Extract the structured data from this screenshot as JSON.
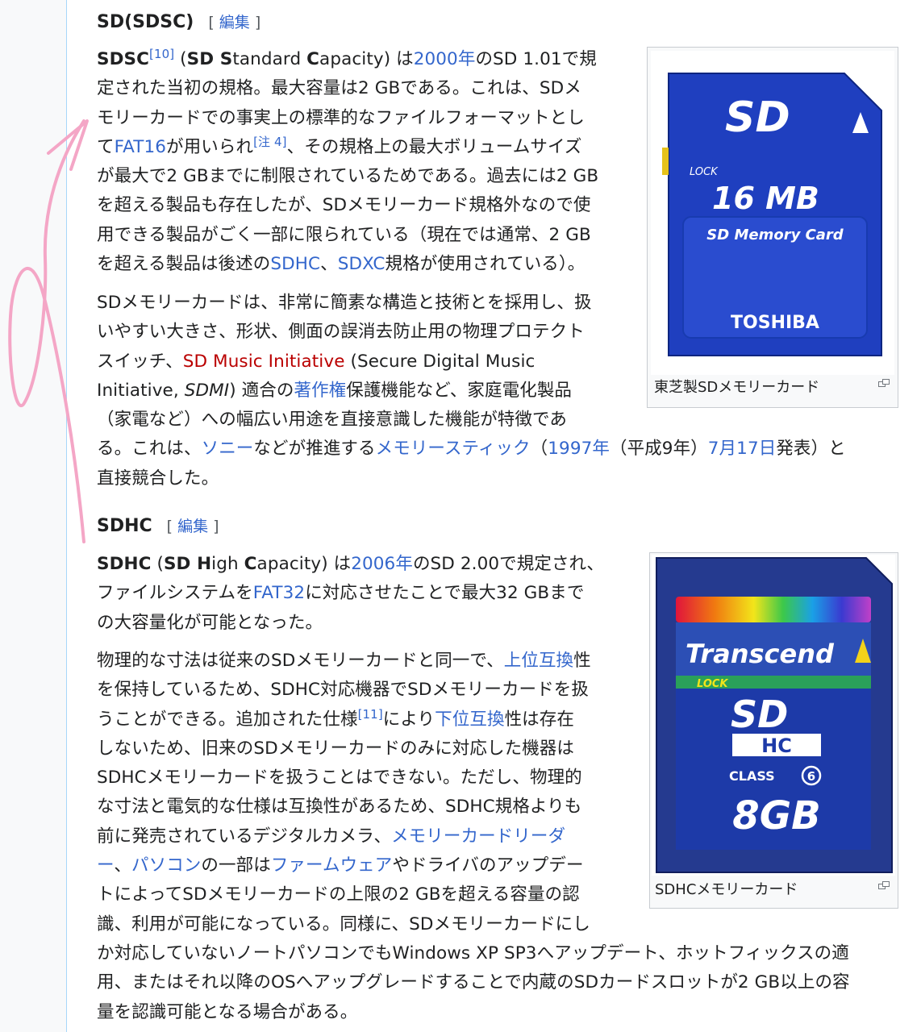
{
  "sdsc": {
    "heading": "SD(SDSC)",
    "edit_label": "編集",
    "para1": {
      "l1": {
        "b1": "SDSC",
        "ref": "[10]",
        "t1": " (",
        "b2": "SD S",
        "t2": "tandard ",
        "b3": "C",
        "t3": "apacity) は",
        "link1": "2000年",
        "t4": "のSD 1.01で規"
      },
      "l2": "定された当初の規格。最大容量は2 GBである。これは、SDメ",
      "l3": "モリーカードでの事実上の標準的なファイルフォーマットとし",
      "l4": {
        "t1": "て",
        "link1": "FAT16",
        "t2": "が用いられ",
        "note": "[注 4]",
        "t3": "、その規格上の最大ボリュームサイズ"
      },
      "l5": "が最大で2 GBまでに制限されているためである。過去には2 GB",
      "l6": "を超える製品も存在したが、SDメモリーカード規格外なので使",
      "l7": "用できる製品がごく一部に限られている（現在では通常、2 GB",
      "l8": {
        "t1": "を超える製品は後述の",
        "link1": "SDHC",
        "t2": "、",
        "link2": "SDXC",
        "t3": "規格が使用されている）。"
      }
    },
    "para2": {
      "l1": "SDメモリーカードは、非常に簡素な構造と技術とを採用し、扱",
      "l2": "いやすい大きさ、形状、側面の誤消去防止用の物理プロテクト",
      "l3": {
        "t1": "スイッチ、",
        "redlink": "SD Music Initiative",
        "t2": " (Secure Digital Music"
      },
      "l4": {
        "t1": "Initiative, ",
        "i1": "SDMI",
        "t2": ") 適合の",
        "link1": "著作権",
        "t3": "保護機能など、家庭電化製品"
      },
      "l5": "（家電など）への幅広い用途を直接意識した機能が特徴であ",
      "l6": {
        "t1": "る。これは、",
        "link1": "ソニー",
        "t2": "などが推進する",
        "link2": "メモリースティック",
        "t3": "（",
        "link3": "1997年",
        "t4": "（平成9年）",
        "link4": "7月17日",
        "t5": "発表）と"
      },
      "l7": "直接競合した。"
    },
    "thumb": {
      "caption": "東芝製SDメモリーカード",
      "card_logo": "SD",
      "card_lock": "LOCK",
      "card_capacity": "16 MB",
      "card_name": "SD Memory Card",
      "card_brand": "TOSHIBA"
    }
  },
  "sdhc": {
    "heading": "SDHC",
    "edit_label": "編集",
    "para1": {
      "l1": {
        "b1": "SDHC",
        "t1": " (",
        "b2": "SD H",
        "t2": "igh ",
        "b3": "C",
        "t3": "apacity) は",
        "link1": "2006年",
        "t4": "のSD 2.00で規定され、"
      },
      "l2": {
        "t1": "ファイルシステムを",
        "link1": "FAT32",
        "t2": "に対応させたことで最大32 GBまで"
      },
      "l3": "の大容量化が可能となった。"
    },
    "para2": {
      "l1": {
        "t1": "物理的な寸法は従来のSDメモリーカードと同一で、",
        "link1": "上位互換",
        "t2": "性"
      },
      "l2": "を保持しているため、SDHC対応機器でSDメモリーカードを扱",
      "l3": {
        "t1": "うことができる。追加された仕様",
        "ref": "[11]",
        "t2": "により",
        "link1": "下位互換",
        "t3": "性は存在"
      },
      "l4": "しないため、旧来のSDメモリーカードのみに対応した機器は",
      "l5": "SDHCメモリーカードを扱うことはできない。ただし、物理的",
      "l6": "な寸法と電気的な仕様は互換性があるため、SDHC規格よりも",
      "l7": {
        "t1": "前に発売されているデジタルカメラ、",
        "link1": "メモリーカードリーダ"
      },
      "l8": {
        "link1": "ー",
        "t1": "、",
        "link2": "パソコン",
        "t2": "の一部は",
        "link3": "ファームウェア",
        "t3": "やドライバのアップデー"
      },
      "l9": "トによってSDメモリーカードの上限の2 GBを超える容量の認",
      "l10": "識、利用が可能になっている。同様に、SDメモリーカードにし",
      "l11": "か対応していないノートパソコンでもWindows XP SP3へアップデート、ホットフィックスの適",
      "l12": "用、またはそれ以降のOSへアップグレードすることで内蔵のSDカードスロットが2 GB以上の容",
      "l13": "量を認識可能となる場合がある。"
    },
    "thumb": {
      "caption": "SDHCメモリーカード",
      "card_brand": "Transcend",
      "card_lock": "LOCK",
      "card_logo": "SD",
      "card_hc": "HC",
      "card_class": "CLASS",
      "card_class_num": "6",
      "card_capacity": "8GB"
    }
  },
  "colors": {
    "link": "#3366cc",
    "redlink": "#ba0000",
    "annotation": "#f4a6c6",
    "toshiba_card": "#1f3fbf",
    "transcend_card": "#253a8f"
  }
}
